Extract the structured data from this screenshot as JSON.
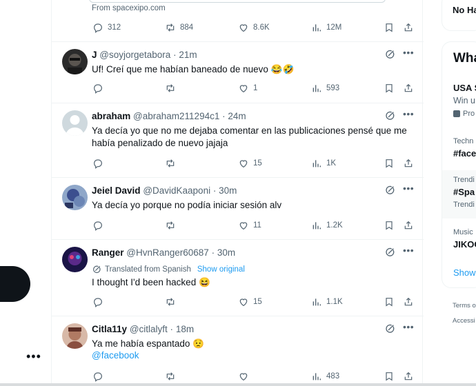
{
  "top_tweet": {
    "card_source": "From spacexipo.com",
    "replies": "312",
    "reposts": "884",
    "likes": "8.6K",
    "views": "12M"
  },
  "tweets": [
    {
      "name": "J",
      "handle": "@soyjorgetabora",
      "time": "21m",
      "text": "Uf! Creí que me habían baneado de nuevo 😂🤣",
      "replies": "",
      "reposts": "",
      "likes": "1",
      "views": "593"
    },
    {
      "name": "abraham",
      "handle": "@abraham211294c1",
      "time": "24m",
      "text": "Ya decía yo que no me dejaba comentar en las publicaciones pensé que me había penalizado de nuevo jajaja",
      "replies": "",
      "reposts": "",
      "likes": "15",
      "views": "1K"
    },
    {
      "name": "Jeiel David",
      "handle": "@DavidKaaponi",
      "time": "30m",
      "text": "Ya decía yo porque no podía iniciar sesión alv",
      "replies": "",
      "reposts": "",
      "likes": "11",
      "views": "1.2K"
    },
    {
      "name": "Ranger",
      "handle": "@HvnRanger60687",
      "time": "30m",
      "translated_label": "Translated from Spanish",
      "show_original": "Show original",
      "text": "I thought I'd been hacked 😆",
      "replies": "",
      "reposts": "",
      "likes": "15",
      "views": "1.1K"
    },
    {
      "name": "Citla11y",
      "handle": "@citlalyft",
      "time": "18m",
      "text": "Ya me había espantado 😟",
      "mention": "@facebook",
      "replies": "",
      "reposts": "",
      "likes": "",
      "views": "483"
    }
  ],
  "sidebar": {
    "top_box_text": "No Ha",
    "trends_title": "What",
    "trends": [
      {
        "category": "",
        "title": "USA S",
        "subtitle": "Win u",
        "promo": "Pro"
      },
      {
        "category": "Techn",
        "title": "#face"
      },
      {
        "category": "Trendi",
        "title": "#Spa",
        "subtitle": "Trendi"
      },
      {
        "category": "Music",
        "title": "JIKOC"
      }
    ],
    "show_more": "Show",
    "footer": [
      "Terms o",
      "Accessi"
    ]
  },
  "colors": {
    "accent": "#1d9bf0",
    "text_primary": "#0f1419",
    "text_secondary": "#536471",
    "border": "#eff3f4"
  },
  "icons": [
    "reply-icon",
    "repost-icon",
    "like-icon",
    "views-icon",
    "bookmark-icon",
    "share-icon",
    "grok-icon",
    "more-icon",
    "translate-icon"
  ]
}
